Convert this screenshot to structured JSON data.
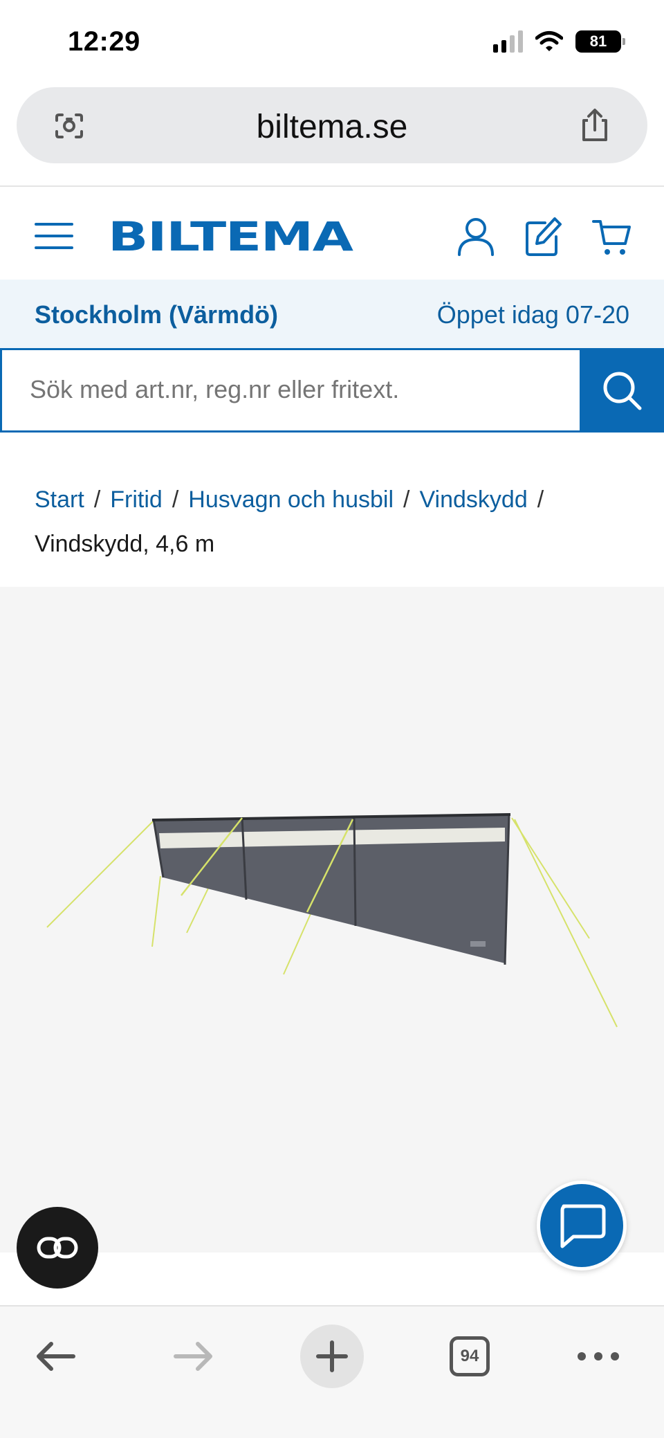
{
  "status_bar": {
    "time": "12:29",
    "battery": "81"
  },
  "browser": {
    "url": "biltema.se",
    "open_tabs": "94"
  },
  "header": {
    "logo_text": "BILTEMA"
  },
  "store": {
    "name": "Stockholm (Värmdö)",
    "hours": "Öppet idag 07-20"
  },
  "search": {
    "placeholder": "Sök med art.nr, reg.nr eller fritext."
  },
  "breadcrumb": {
    "items": [
      "Start",
      "Fritid",
      "Husvagn och husbil",
      "Vindskydd"
    ],
    "separator": "/",
    "current": "Vindskydd, 4,6 m"
  },
  "product": {
    "image_label": "Vindskydd, 4,6 m"
  },
  "colors": {
    "brand": "#0a69b4",
    "brand_dark": "#0c5e9e",
    "store_bar_bg": "#eef5fa"
  },
  "icons": {
    "url_left": "visual-lookup-icon",
    "url_right": "share-icon",
    "header": [
      "menu-icon",
      "user-icon",
      "edit-icon",
      "cart-icon"
    ],
    "search": "search-icon",
    "chat": "chat-icon",
    "reader": "reader-icon",
    "toolbar": [
      "back-arrow-icon",
      "forward-arrow-icon",
      "plus-icon",
      "tabs-icon",
      "more-icon"
    ]
  }
}
